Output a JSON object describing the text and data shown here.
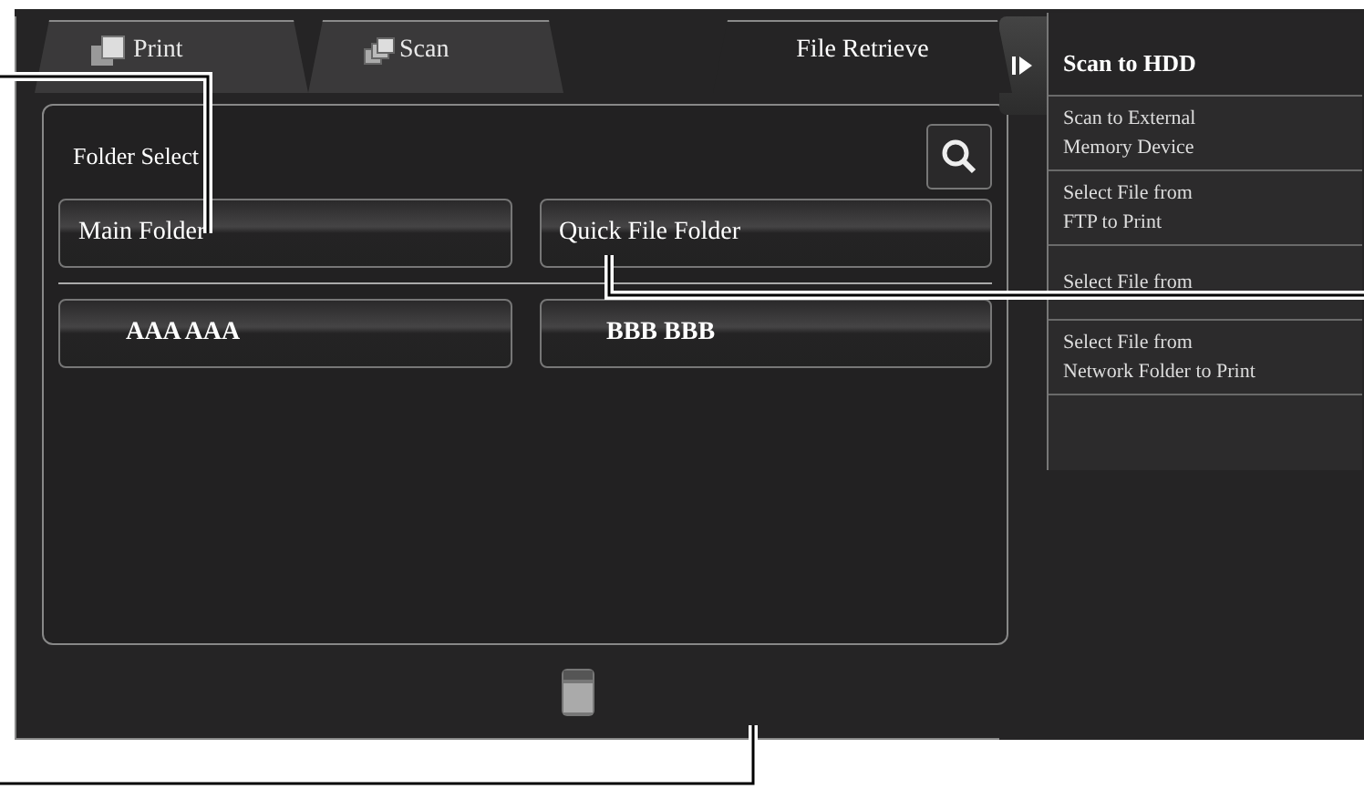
{
  "tabs": [
    {
      "label": "Print",
      "selected": false
    },
    {
      "label": "Scan",
      "selected": false
    },
    {
      "label": "File Retrieve",
      "selected": true
    }
  ],
  "panel": {
    "title": "Folder Select"
  },
  "folders": [
    {
      "label": "Main Folder",
      "kind": "system"
    },
    {
      "label": "Quick File Folder",
      "kind": "system"
    },
    {
      "label": "AAA AAA",
      "kind": "user"
    },
    {
      "label": "BBB BBB",
      "kind": "user"
    }
  ],
  "side_menu": [
    {
      "lines": [
        "Scan to HDD"
      ],
      "selected": true
    },
    {
      "lines": [
        "Scan to External",
        "Memory Device"
      ],
      "selected": false
    },
    {
      "lines": [
        "Select File from",
        "FTP to Print"
      ],
      "selected": false
    },
    {
      "lines": [
        "Select File from"
      ],
      "selected": false
    },
    {
      "lines": [
        "Select File from",
        "Network Folder to Print"
      ],
      "selected": false
    }
  ]
}
